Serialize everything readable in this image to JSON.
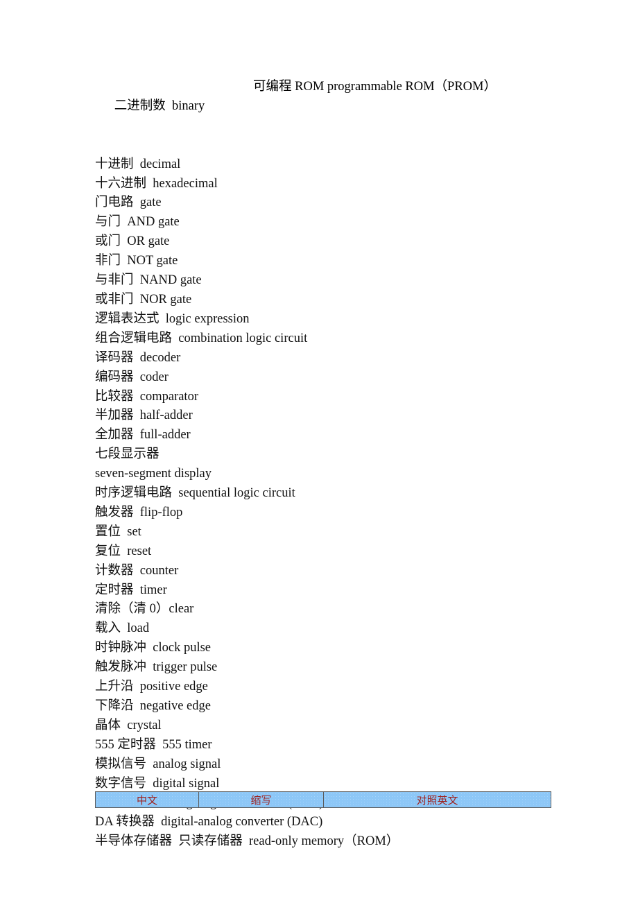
{
  "document": {
    "right_column_term": "可编程 ROM programmable ROM（PROM）",
    "terms": [
      "二进制数  binary",
      "十进制  decimal",
      "十六进制  hexadecimal",
      "门电路  gate",
      "与门  AND gate",
      "或门  OR gate",
      "非门  NOT gate",
      "与非门  NAND gate",
      "或非门  NOR gate",
      "逻辑表达式  logic expression",
      "组合逻辑电路  combination logic circuit",
      "译码器  decoder",
      "编码器  coder",
      "比较器  comparator",
      "半加器  half-adder",
      "全加器  full-adder",
      "七段显示器",
      "seven-segment display",
      "时序逻辑电路  sequential logic circuit",
      "触发器  flip-flop",
      "置位  set",
      "复位  reset",
      "计数器  counter",
      "定时器  timer",
      "清除（清 0）clear",
      "载入  load",
      "时钟脉冲  clock pulse",
      "触发脉冲  trigger pulse",
      "上升沿  positive edge",
      "下降沿  negative edge",
      "晶体  crystal",
      "555 定时器  555 timer",
      "模拟信号  analog signal",
      "数字信号  digital signal",
      "AD 转换器 analog -digital converter (ADC)",
      "DA 转换器  digital-analog converter (DAC)",
      "半导体存储器  只读存储器  read-only memory（ROM）"
    ]
  },
  "table": {
    "headers": [
      "中文",
      "缩写",
      "对照英文"
    ],
    "header_bg": "#8dc7f7",
    "header_text_color": "#9e2321",
    "border_color": "#5b5b5b"
  }
}
